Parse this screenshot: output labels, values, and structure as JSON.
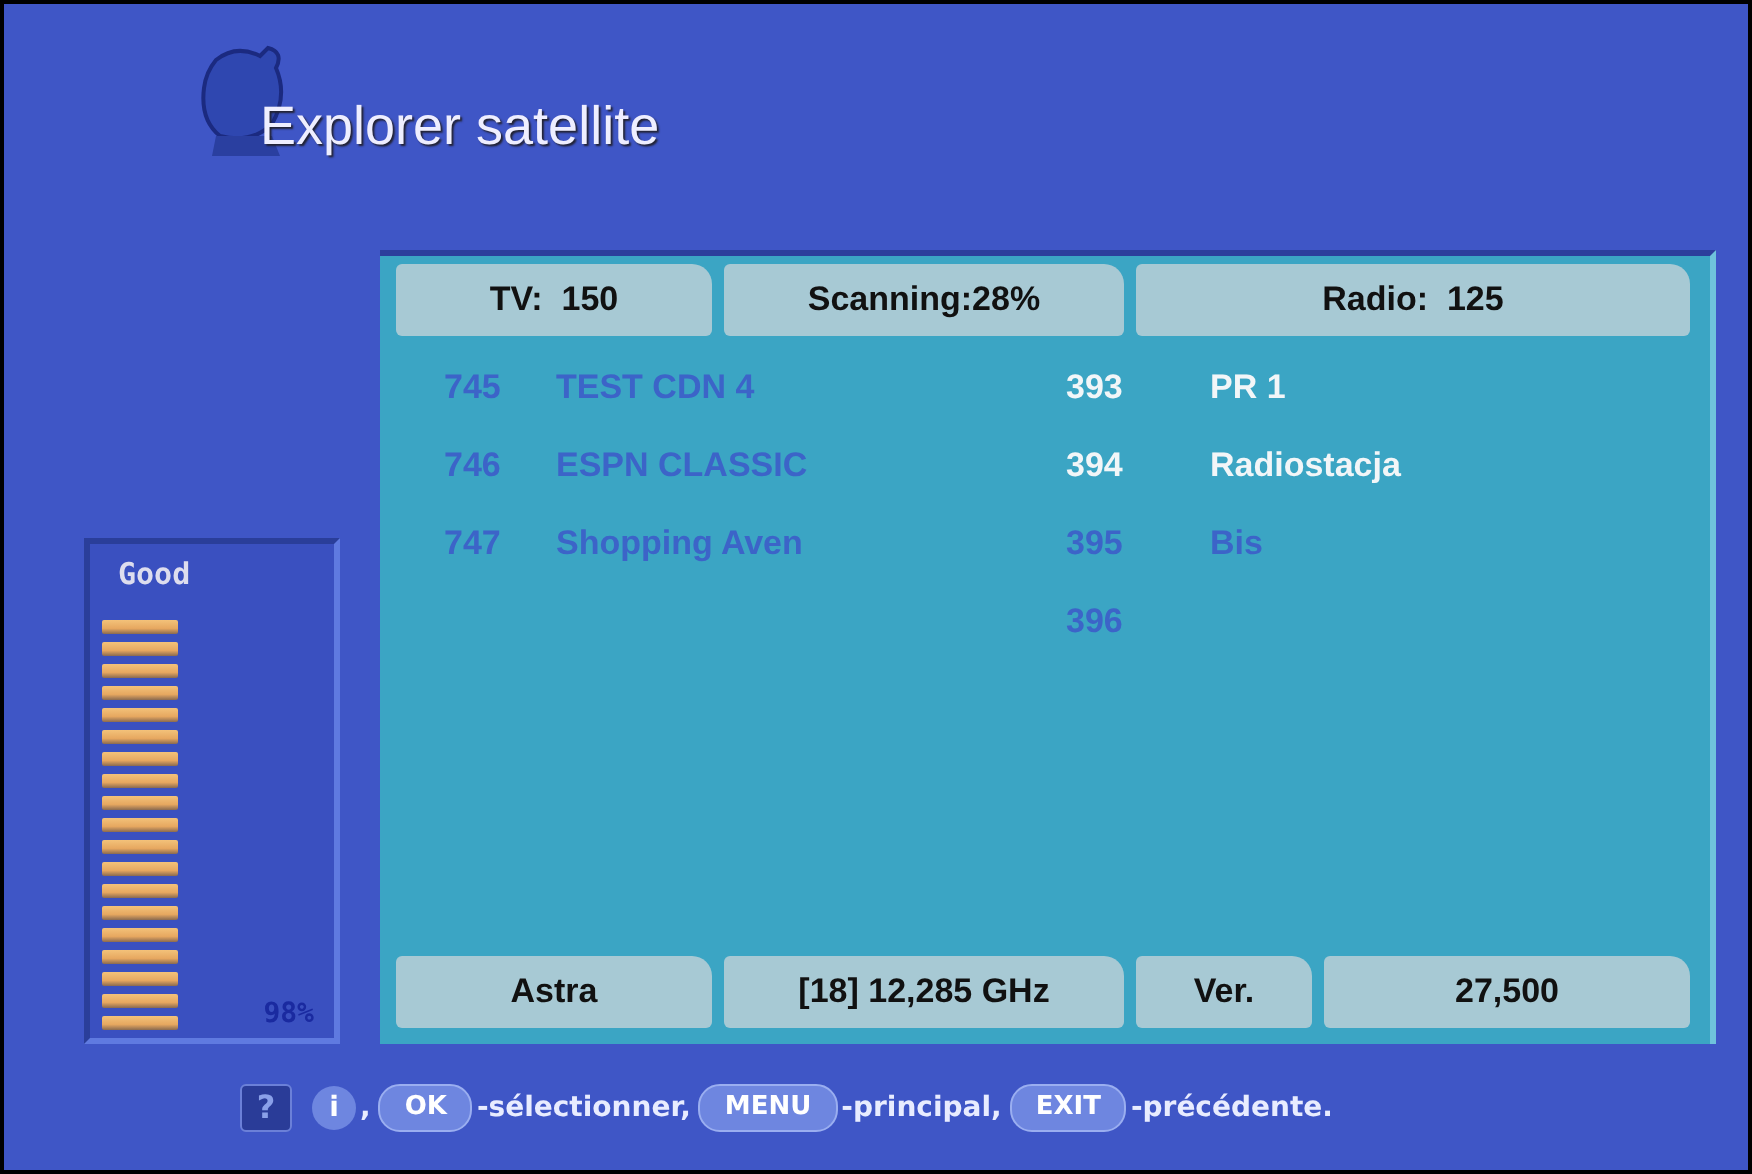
{
  "title": "Explorer satellite",
  "status": {
    "tv": "TV:  150",
    "scanning": "Scanning:28%",
    "radio": "Radio:  125"
  },
  "tv_channels": [
    {
      "number": "745",
      "name": "TEST CDN 4",
      "highlighted": false
    },
    {
      "number": "746",
      "name": "ESPN CLASSIC",
      "highlighted": false
    },
    {
      "number": "747",
      "name": "Shopping Aven",
      "highlighted": false
    }
  ],
  "radio_channels": [
    {
      "number": "393",
      "name": "PR 1",
      "highlighted": true
    },
    {
      "number": "394",
      "name": "Radiostacja",
      "highlighted": true
    },
    {
      "number": "395",
      "name": "Bis",
      "highlighted": false
    },
    {
      "number": "396",
      "highlighted": false
    }
  ],
  "signal": {
    "quality": "Good",
    "level": 0.98,
    "reading": "98%"
  },
  "transponder": {
    "satellite": "Astra",
    "frequency": "[18] 12,285 GHz",
    "polarization": "Ver.",
    "symbol_rate": "27,500"
  },
  "help_bar": [
    {
      "kind": "square",
      "key": "?"
    },
    {
      "kind": "circle",
      "key": "i",
      "text": ","
    },
    {
      "kind": "pill",
      "key": "OK",
      "text": "-sélectionner,"
    },
    {
      "kind": "pill",
      "key": "MENU",
      "text": "-principal,"
    },
    {
      "kind": "pill",
      "key": "EXIT",
      "text": "-précédente."
    }
  ]
}
